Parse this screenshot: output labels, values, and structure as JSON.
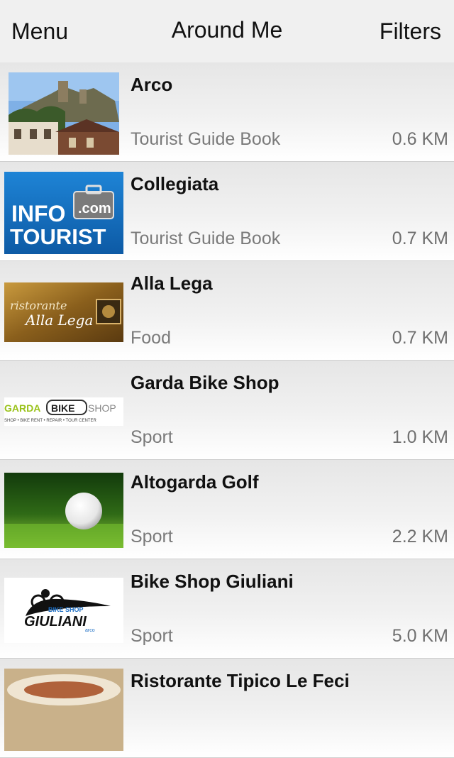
{
  "navbar": {
    "menu_label": "Menu",
    "title": "Around Me",
    "filters_label": "Filters"
  },
  "items": [
    {
      "title": "Arco",
      "category": "Tourist Guide Book",
      "distance": "0.6 KM"
    },
    {
      "title": "Collegiata",
      "category": "Tourist Guide Book",
      "distance": "0.7 KM",
      "thumb_text": {
        "line1": "INFO",
        "badge": ".com",
        "line2": "TOURIST"
      }
    },
    {
      "title": "Alla Lega",
      "category": "Food",
      "distance": "0.7 KM",
      "thumb_text": {
        "line1": "ristorante",
        "line2": "Alla Lega"
      }
    },
    {
      "title": "Garda Bike Shop",
      "category": "Sport",
      "distance": "1.0 KM",
      "thumb_text": {
        "part1": "GARDA",
        "part2": "BIKE",
        "part3": "SHOP",
        "tagline": "SHOP • BIKE RENT • REPAIR • TOUR CENTER"
      }
    },
    {
      "title": "Altogarda Golf",
      "category": "Sport",
      "distance": "2.2 KM"
    },
    {
      "title": "Bike Shop Giuliani",
      "category": "Sport",
      "distance": "5.0 KM",
      "thumb_text": {
        "small": "BIKE SHOP",
        "big": "GIULIANI",
        "tiny": "arco"
      }
    },
    {
      "title": "Ristorante Tipico Le Feci",
      "category": "",
      "distance": ""
    }
  ]
}
